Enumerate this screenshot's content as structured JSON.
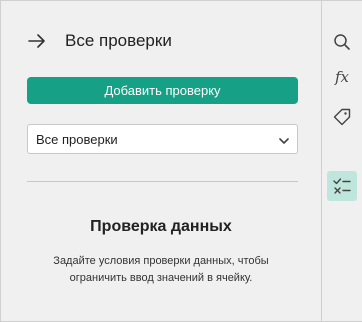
{
  "panel": {
    "header_title": "Все проверки",
    "add_button_label": "Добавить проверку",
    "filter": {
      "selected": "Все проверки"
    },
    "empty_state": {
      "title": "Проверка данных",
      "description": "Задайте условия проверки данных, чтобы ограничить ввод значений в ячейку."
    }
  },
  "sidebar": {
    "items": [
      {
        "icon": "search-icon"
      },
      {
        "icon": "function-icon",
        "label": "fx"
      },
      {
        "icon": "tag-icon"
      },
      {
        "icon": "data-validation-icon",
        "active": true
      }
    ]
  },
  "colors": {
    "accent": "#16a085",
    "active_icon_bg": "#bfe6dd",
    "background": "#f0f0f0"
  }
}
